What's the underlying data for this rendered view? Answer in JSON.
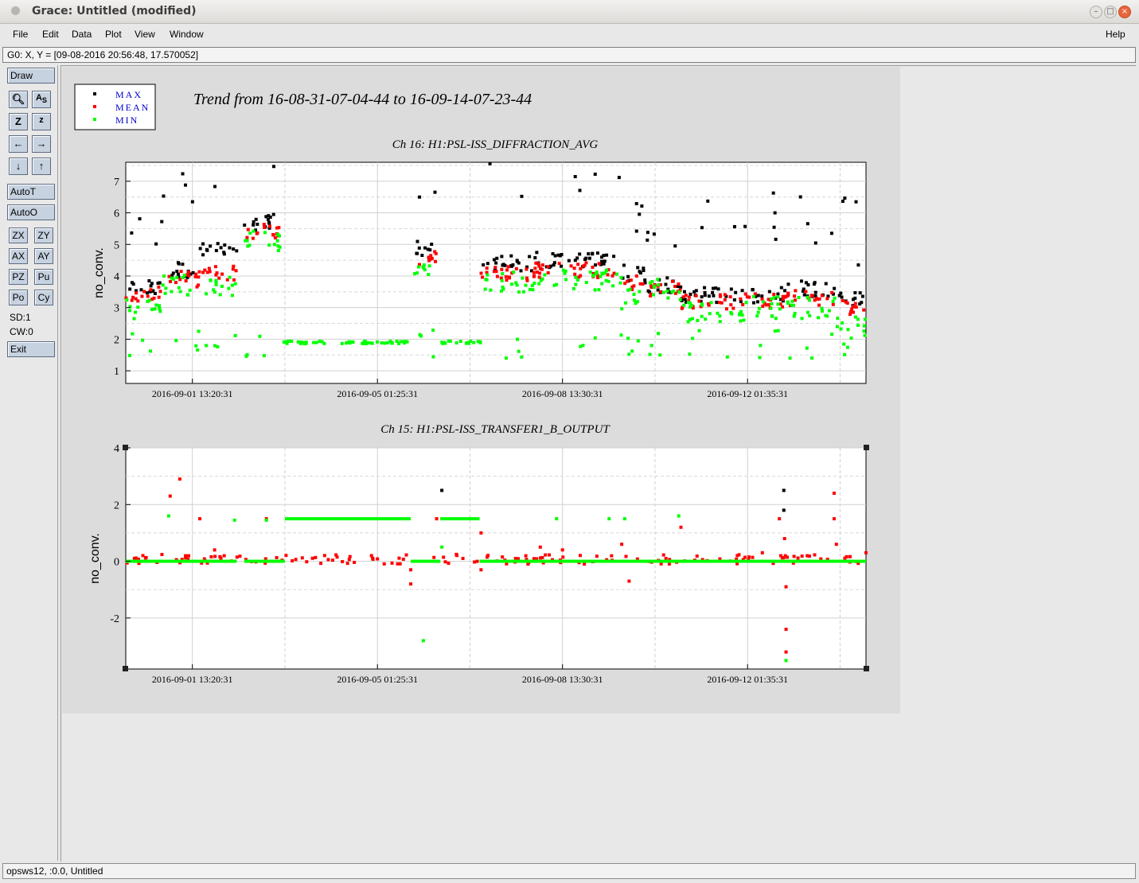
{
  "window": {
    "title": "Grace: Untitled (modified)"
  },
  "menubar": {
    "items": [
      {
        "label": "File",
        "x": 16
      },
      {
        "label": "Edit",
        "x": 53
      },
      {
        "label": "Data",
        "x": 90
      },
      {
        "label": "Plot",
        "x": 132
      },
      {
        "label": "View",
        "x": 169
      },
      {
        "label": "Window",
        "x": 213
      }
    ],
    "help": "Help"
  },
  "locator": {
    "text": "G0: X, Y = [09-08-2016 20:56:48, 17.570052]"
  },
  "toolbar": {
    "draw": "Draw",
    "autot": "AutoT",
    "autoo": "AutoO",
    "zx": "ZX",
    "zy": "ZY",
    "ax": "AX",
    "ay": "AY",
    "pz": "PZ",
    "pu": "Pu",
    "po": "Po",
    "cy": "Cy",
    "sd": "SD:1",
    "cw": "CW:0",
    "exit": "Exit"
  },
  "status": {
    "text": "opsws12, :0.0, Untitled"
  },
  "plot": {
    "main_title": "Trend from 16-08-31-07-04-44 to 16-09-14-07-23-44",
    "legend": [
      {
        "label": "MAX",
        "color": "#000000"
      },
      {
        "label": "MEAN",
        "color": "#ff0000"
      },
      {
        "label": "MIN",
        "color": "#00ff00"
      }
    ],
    "x_ticks": [
      "2016-09-01 13:20:31",
      "2016-09-05 01:25:31",
      "2016-09-08 13:30:31",
      "2016-09-12 01:35:31"
    ]
  },
  "chart_data": [
    {
      "type": "scatter",
      "title": "Ch 16: H1:PSL-ISS_DIFFRACTION_AVG",
      "ylabel": "no_conv.",
      "xlabel": "",
      "x_tick_labels": [
        "2016-09-01 13:20:31",
        "2016-09-05 01:25:31",
        "2016-09-08 13:30:31",
        "2016-09-12 01:35:31"
      ],
      "y_ticks": [
        1,
        2,
        3,
        4,
        5,
        6,
        7
      ],
      "ylim": [
        0.6,
        7.6
      ],
      "grid": true,
      "series": [
        {
          "name": "MAX",
          "color": "#000000",
          "segments": [
            {
              "t": [
                0.0,
                0.05
              ],
              "y": 3.6
            },
            {
              "t": [
                0.05,
                0.1
              ],
              "y": 4.2
            },
            {
              "t": [
                0.1,
                0.15
              ],
              "y": 4.8
            },
            {
              "t": [
                0.16,
                0.21
              ],
              "y": 5.7
            },
            {
              "t": [
                0.39,
                0.42
              ],
              "y": 4.9
            },
            {
              "t": [
                0.48,
                0.55
              ],
              "y": 4.4
            },
            {
              "t": [
                0.55,
                0.67
              ],
              "y": 4.5
            },
            {
              "t": [
                0.67,
                0.7
              ],
              "y": 4.1
            },
            {
              "t": [
                0.7,
                0.75
              ],
              "y": 3.7
            },
            {
              "t": [
                0.75,
                0.84
              ],
              "y": 3.4
            },
            {
              "t": [
                0.84,
                0.89
              ],
              "y": 3.4
            },
            {
              "t": [
                0.89,
                0.96
              ],
              "y": 3.6
            },
            {
              "t": [
                0.96,
                1.0
              ],
              "y": 3.3
            }
          ]
        },
        {
          "name": "MEAN",
          "color": "#ff0000",
          "segments": [
            {
              "t": [
                0.0,
                0.05
              ],
              "y": 3.4
            },
            {
              "t": [
                0.05,
                0.1
              ],
              "y": 3.9
            },
            {
              "t": [
                0.1,
                0.15
              ],
              "y": 4.1
            },
            {
              "t": [
                0.16,
                0.21
              ],
              "y": 5.4
            },
            {
              "t": [
                0.39,
                0.42
              ],
              "y": 4.6
            },
            {
              "t": [
                0.48,
                0.55
              ],
              "y": 4.1
            },
            {
              "t": [
                0.55,
                0.67
              ],
              "y": 4.2
            },
            {
              "t": [
                0.67,
                0.7
              ],
              "y": 3.8
            },
            {
              "t": [
                0.7,
                0.75
              ],
              "y": 3.6
            },
            {
              "t": [
                0.75,
                0.84
              ],
              "y": 3.2
            },
            {
              "t": [
                0.84,
                0.89
              ],
              "y": 3.2
            },
            {
              "t": [
                0.89,
                0.96
              ],
              "y": 3.3
            },
            {
              "t": [
                0.96,
                1.0
              ],
              "y": 3.0
            }
          ]
        },
        {
          "name": "MIN",
          "color": "#00ff00",
          "segments": [
            {
              "t": [
                0.0,
                0.05
              ],
              "y": 3.0
            },
            {
              "t": [
                0.05,
                0.1
              ],
              "y": 3.7
            },
            {
              "t": [
                0.1,
                0.15
              ],
              "y": 3.7
            },
            {
              "t": [
                0.16,
                0.21
              ],
              "y": 5.1
            },
            {
              "t": [
                0.21,
                0.39
              ],
              "y": 1.9
            },
            {
              "t": [
                0.39,
                0.42
              ],
              "y": 4.3
            },
            {
              "t": [
                0.42,
                0.48
              ],
              "y": 1.9
            },
            {
              "t": [
                0.48,
                0.55
              ],
              "y": 3.8
            },
            {
              "t": [
                0.55,
                0.67
              ],
              "y": 3.9
            },
            {
              "t": [
                0.67,
                0.7
              ],
              "y": 3.3
            },
            {
              "t": [
                0.7,
                0.75
              ],
              "y": 3.6
            },
            {
              "t": [
                0.75,
                0.84
              ],
              "y": 2.9
            },
            {
              "t": [
                0.84,
                0.89
              ],
              "y": 3.0
            },
            {
              "t": [
                0.89,
                0.96
              ],
              "y": 3.0
            },
            {
              "t": [
                0.96,
                1.0
              ],
              "y": 2.4
            }
          ]
        }
      ]
    },
    {
      "type": "scatter",
      "title": "Ch 15: H1:PSL-ISS_TRANSFER1_B_OUTPUT",
      "ylabel": "no_conv.",
      "xlabel": "",
      "x_tick_labels": [
        "2016-09-01 13:20:31",
        "2016-09-05 01:25:31",
        "2016-09-08 13:30:31",
        "2016-09-12 01:35:31"
      ],
      "y_ticks": [
        -2,
        0,
        2,
        4
      ],
      "ylim": [
        -3.8,
        4.0
      ],
      "grid": true,
      "series": [
        {
          "name": "MAX",
          "color": "#000000",
          "points": [
            [
              0.427,
              2.5
            ],
            [
              0.889,
              2.5
            ],
            [
              0.889,
              1.8
            ]
          ]
        },
        {
          "name": "MEAN",
          "color": "#ff0000",
          "points": [
            [
              0.06,
              2.3
            ],
            [
              0.073,
              2.9
            ],
            [
              0.1,
              1.5
            ],
            [
              0.12,
              0.4
            ],
            [
              0.19,
              1.5
            ],
            [
              0.385,
              -0.3
            ],
            [
              0.385,
              -0.8
            ],
            [
              0.42,
              1.5
            ],
            [
              0.48,
              1.0
            ],
            [
              0.48,
              -0.3
            ],
            [
              0.56,
              0.5
            ],
            [
              0.59,
              0.4
            ],
            [
              0.67,
              0.6
            ],
            [
              0.68,
              -0.7
            ],
            [
              0.75,
              1.2
            ],
            [
              0.86,
              0.3
            ],
            [
              0.883,
              1.5
            ],
            [
              0.89,
              0.8
            ],
            [
              0.892,
              -0.9
            ],
            [
              0.892,
              -2.4
            ],
            [
              0.892,
              -3.2
            ],
            [
              0.957,
              2.4
            ],
            [
              0.957,
              1.5
            ],
            [
              0.96,
              0.6
            ],
            [
              1.0,
              0.3
            ]
          ]
        },
        {
          "name": "MIN",
          "color": "#00ff00",
          "points": [
            [
              0.058,
              1.6
            ],
            [
              0.147,
              1.45
            ],
            [
              0.19,
              1.45
            ],
            [
              0.427,
              1.5
            ],
            [
              0.427,
              0.5
            ],
            [
              0.402,
              -2.8
            ],
            [
              0.582,
              1.5
            ],
            [
              0.653,
              1.5
            ],
            [
              0.674,
              1.5
            ],
            [
              0.747,
              1.6
            ],
            [
              0.892,
              -3.5
            ]
          ],
          "baseline_segments": [
            [
              0.0,
              0.15,
              0.0
            ],
            [
              0.16,
              0.215,
              0.0
            ],
            [
              0.215,
              0.385,
              1.5
            ],
            [
              0.385,
              0.425,
              0.0
            ],
            [
              0.428,
              0.478,
              1.5
            ],
            [
              0.478,
              1.0,
              0.0
            ]
          ]
        }
      ]
    }
  ]
}
